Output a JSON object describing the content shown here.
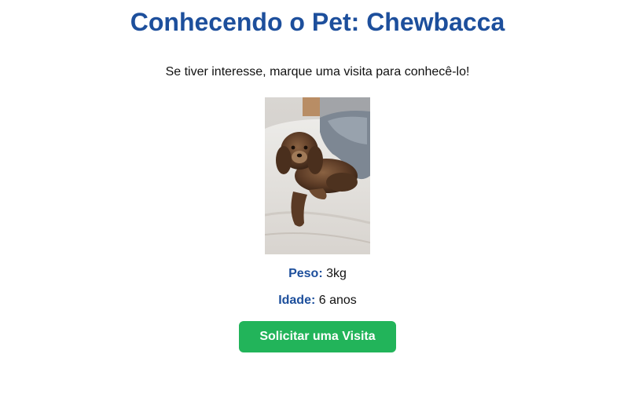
{
  "header": {
    "title": "Conhecendo o Pet: Chewbacca"
  },
  "main": {
    "subtitle": "Se tiver interesse, marque uma visita para conhecê-lo!",
    "weight": {
      "label": "Peso:",
      "value": "3kg"
    },
    "age": {
      "label": "Idade:",
      "value": "6 anos"
    },
    "visit_button_label": "Solicitar uma Visita"
  },
  "colors": {
    "heading": "#1d4f9c",
    "button": "#22b45a",
    "text": "#111111"
  }
}
